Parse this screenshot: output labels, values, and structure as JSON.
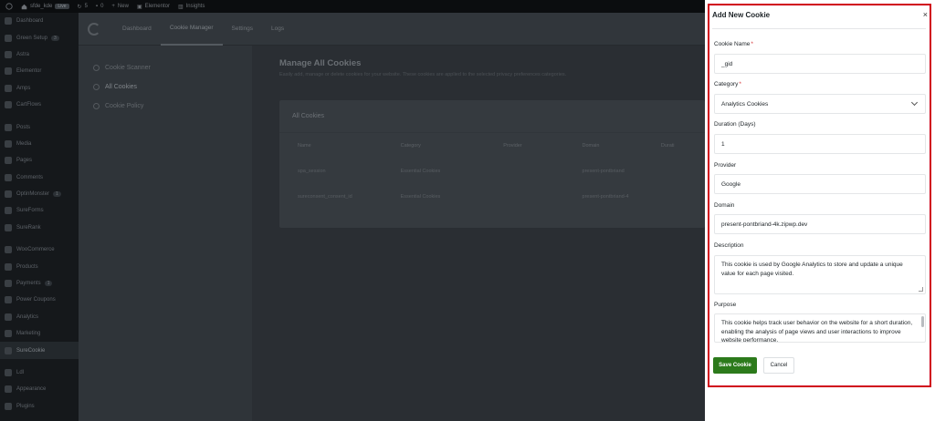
{
  "adminbar": {
    "items": [
      {
        "icon": "wordpress-icon",
        "label": ""
      },
      {
        "icon": "home-icon",
        "label": "sfde_kde"
      },
      {
        "icon": "badge",
        "label": "Live"
      },
      {
        "icon": "refresh-icon",
        "label": "5"
      },
      {
        "icon": "comment-icon",
        "label": "0"
      },
      {
        "icon": "plus-icon",
        "label": "New"
      },
      {
        "icon": "edit-icon",
        "label": "Elementor"
      },
      {
        "icon": "chart-icon",
        "label": "Insights"
      }
    ]
  },
  "sidebar": {
    "items": [
      {
        "label": "Dashboard"
      },
      {
        "label": "Green Setup",
        "badge": "3"
      },
      {
        "label": "Astra"
      },
      {
        "label": "Elementor"
      },
      {
        "label": "Amps"
      },
      {
        "label": "CartFlows"
      },
      {
        "gap": true
      },
      {
        "label": "Posts"
      },
      {
        "label": "Media"
      },
      {
        "label": "Pages"
      },
      {
        "label": "Comments"
      },
      {
        "label": "OptinMonster",
        "badge": "1"
      },
      {
        "label": "SureForms"
      },
      {
        "label": "SureRank"
      },
      {
        "gap": true
      },
      {
        "label": "WooCommerce"
      },
      {
        "label": "Products"
      },
      {
        "label": "Payments",
        "badge": "1"
      },
      {
        "label": "Power Coupons"
      },
      {
        "label": "Analytics"
      },
      {
        "label": "Marketing"
      },
      {
        "label": "SureCookie",
        "active": true
      },
      {
        "gap": true
      },
      {
        "label": "Ldl"
      },
      {
        "label": "Appearance"
      },
      {
        "label": "Plugins"
      }
    ]
  },
  "topnav": {
    "tabs": [
      {
        "label": "Dashboard"
      },
      {
        "label": "Cookie Manager",
        "active": true
      },
      {
        "label": "Settings"
      },
      {
        "label": "Logs"
      }
    ]
  },
  "leftnav": {
    "items": [
      {
        "label": "Cookie Scanner"
      },
      {
        "label": "All Cookies",
        "active": true
      },
      {
        "label": "Cookie Policy"
      }
    ]
  },
  "content": {
    "title": "Manage All Cookies",
    "subtitle": "Easily add, manage or delete cookies for your website. These cookies are applied to the selected privacy preferences categories.",
    "card_title": "All Cookies",
    "columns": [
      "Name",
      "Category",
      "Provider",
      "Domain",
      "Durati"
    ],
    "rows": [
      [
        "spa_session",
        "Essential Cookies",
        "",
        "present-pontbriand",
        ""
      ],
      [
        "sureconsent_consent_id",
        "Essential Cookies",
        "",
        "present-pontbriand-4",
        ""
      ]
    ]
  },
  "drawer": {
    "title": "Add New Cookie",
    "close_label": "×",
    "fields": {
      "name": {
        "label": "Cookie Name",
        "required": "*",
        "value": "_gid"
      },
      "category": {
        "label": "Category",
        "required": "*",
        "value": "Analytics Cookies"
      },
      "duration": {
        "label": "Duration (Days)",
        "value": "1"
      },
      "provider": {
        "label": "Provider",
        "value": "Google"
      },
      "domain": {
        "label": "Domain",
        "value": "present-pontbriand-4k.zipwp.dev"
      },
      "description": {
        "label": "Description",
        "value": "This cookie is used by Google Analytics to store and update a unique value for each page visited."
      },
      "purpose": {
        "label": "Purpose",
        "value": "This cookie helps track user behavior on the website for a short duration, enabling the analysis of page views and user interactions to improve website performance."
      }
    },
    "save_label": "Save Cookie",
    "cancel_label": "Cancel"
  },
  "colors": {
    "highlight_border": "#d0021b",
    "primary_button": "#2c7a1b",
    "required": "#d63638"
  }
}
